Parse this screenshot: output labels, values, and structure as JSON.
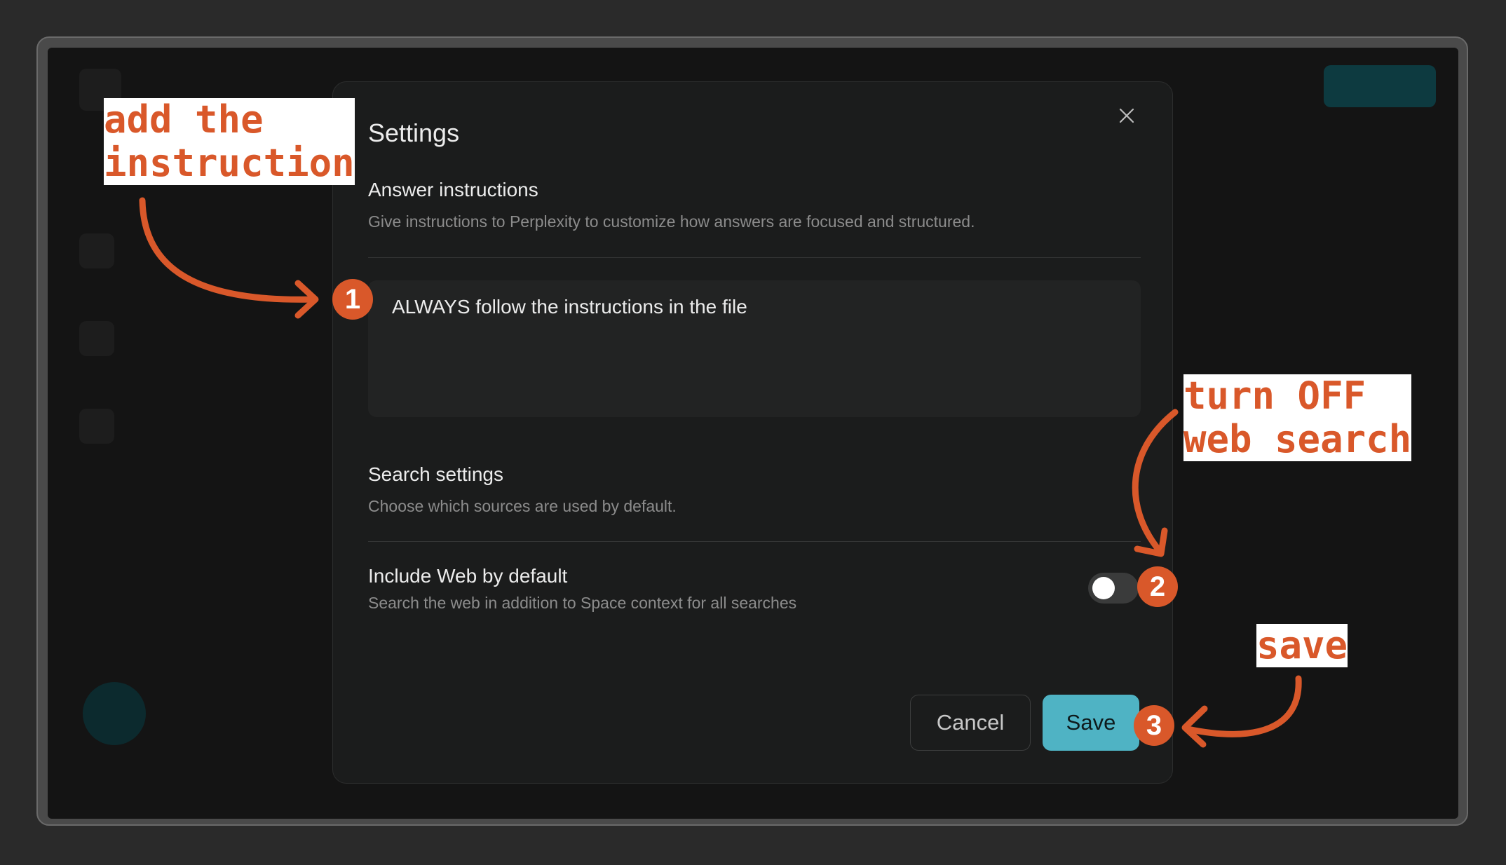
{
  "modal": {
    "title": "Settings",
    "close_icon": "close-icon",
    "answer_instructions": {
      "title": "Answer instructions",
      "description": "Give instructions to Perplexity to customize how answers are focused and structured.",
      "value": "ALWAYS follow the instructions in the file"
    },
    "search_settings": {
      "title": "Search settings",
      "description": "Choose which sources are used by default."
    },
    "include_web": {
      "label": "Include Web by default",
      "description": "Search the web in addition to Space context for all searches",
      "enabled": false
    },
    "buttons": {
      "cancel": "Cancel",
      "save": "Save"
    }
  },
  "annotations": {
    "note1": "add the\ninstruction",
    "note2": "turn OFF\nweb search",
    "note3": "save",
    "badge1": "1",
    "badge2": "2",
    "badge3": "3",
    "color": "#d9582a"
  },
  "colors": {
    "accent": "#4fb3c4",
    "background": "#141414",
    "modal": "#1b1c1c"
  }
}
